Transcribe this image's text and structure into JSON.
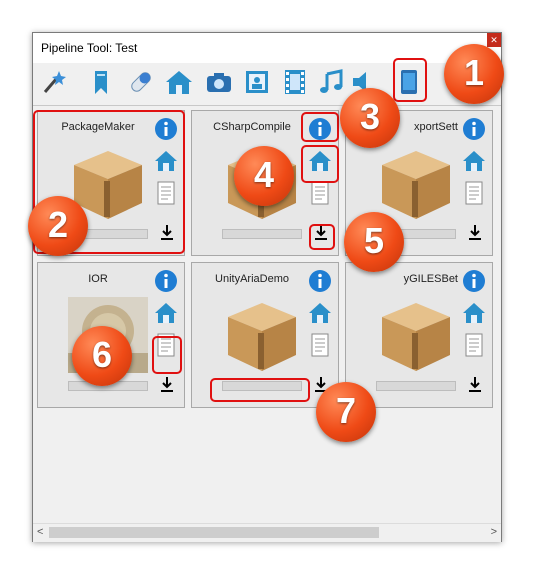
{
  "window": {
    "title": "Pipeline Tool: Test",
    "close_icon": "close-icon"
  },
  "toolbar": {
    "icons": [
      "magic-wand-icon",
      "bookmark-icon",
      "pill-icon",
      "home-icon",
      "camera-icon",
      "portrait-icon",
      "film-icon",
      "music-icon",
      "speaker-icon",
      "device-icon"
    ]
  },
  "tiles": [
    {
      "name": "PackageMaker",
      "progress": 0
    },
    {
      "name": "CSharpCompile",
      "progress": 0
    },
    {
      "name": "xportSett",
      "progress": 0
    },
    {
      "name": "IOR",
      "progress": 0
    },
    {
      "name": "UnityAriaDemo",
      "progress": 0
    },
    {
      "name": "yGILESBet",
      "progress": 0
    }
  ],
  "badges": [
    "1",
    "2",
    "3",
    "4",
    "5",
    "6",
    "7"
  ],
  "colors": {
    "badge": "#ef4a16",
    "highlight": "#e01010",
    "info_blue": "#1f7dd3"
  }
}
